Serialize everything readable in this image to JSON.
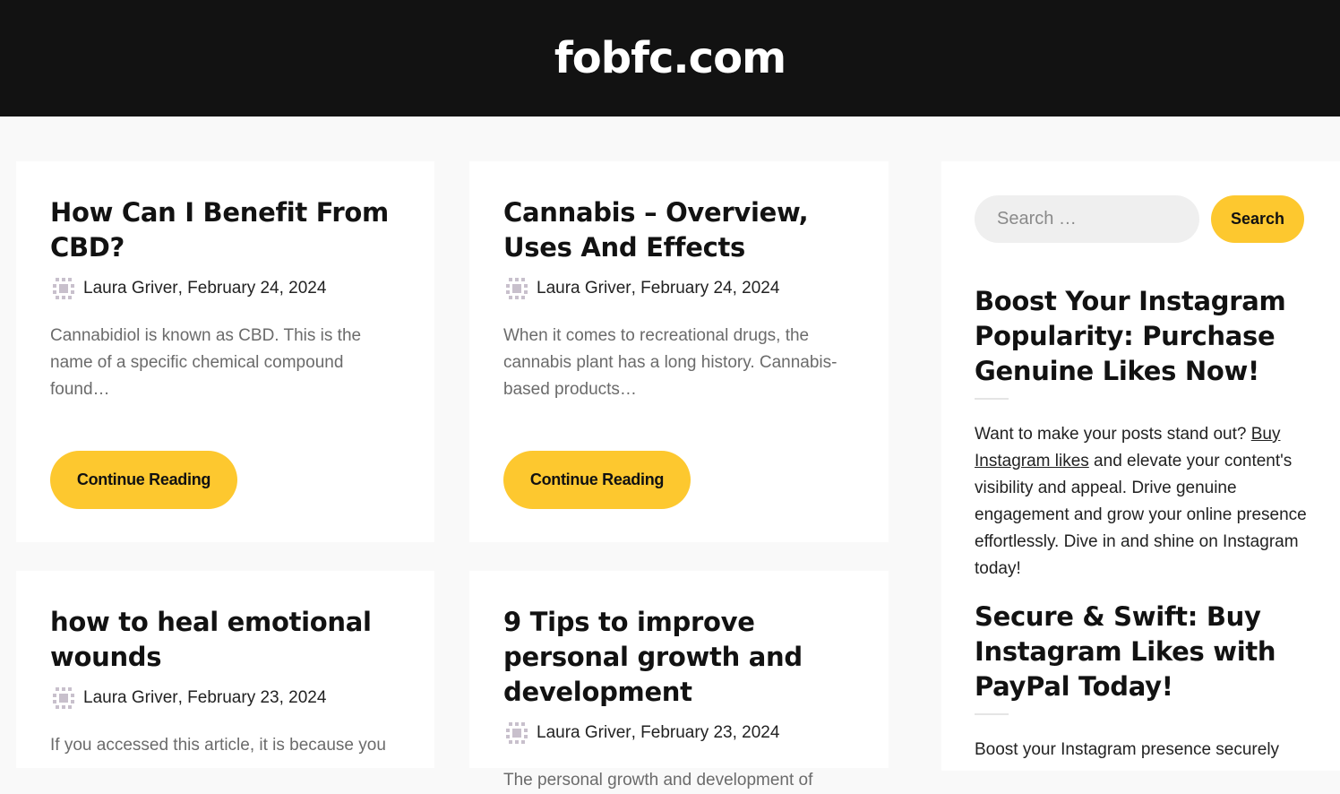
{
  "header": {
    "site_title": "fobfc.com"
  },
  "posts": [
    {
      "title": "How Can I Benefit From CBD?",
      "author": "Laura Griver",
      "date": "February 24, 2024",
      "excerpt": "Cannabidiol is known as CBD. This is the name of a specific chemical compound found…",
      "button_label": "Continue Reading"
    },
    {
      "title": "Cannabis – Overview, Uses And Effects",
      "author": "Laura Griver",
      "date": "February 24, 2024",
      "excerpt": "When it comes to recreational drugs, the cannabis plant has a long history. Cannabis-based products…",
      "button_label": "Continue Reading"
    },
    {
      "title": "how to heal emotional wounds",
      "author": "Laura Griver",
      "date": "February 23, 2024",
      "excerpt": "If you accessed this article, it is because you"
    },
    {
      "title": "9 Tips to improve personal growth and development",
      "author": "Laura Griver",
      "date": "February 23, 2024",
      "excerpt": "The personal growth and development of"
    }
  ],
  "sidebar": {
    "search_placeholder": "Search …",
    "search_button": "Search",
    "widgets": [
      {
        "title": "Boost Your Instagram Popularity: Purchase Genuine Likes Now!",
        "text_before": "Want to make your posts stand out? ",
        "link_text": "Buy Instagram likes",
        "text_after": " and elevate your content's visibility and appeal. Drive genuine engagement and grow your online presence effortlessly. Dive in and shine on Instagram today!"
      },
      {
        "title": "Secure & Swift: Buy Instagram Likes with PayPal Today!",
        "text": "Boost your Instagram presence securely"
      }
    ]
  },
  "colors": {
    "accent": "#fdc82f",
    "header_bg": "#121212",
    "page_bg": "#f9f9f9"
  }
}
